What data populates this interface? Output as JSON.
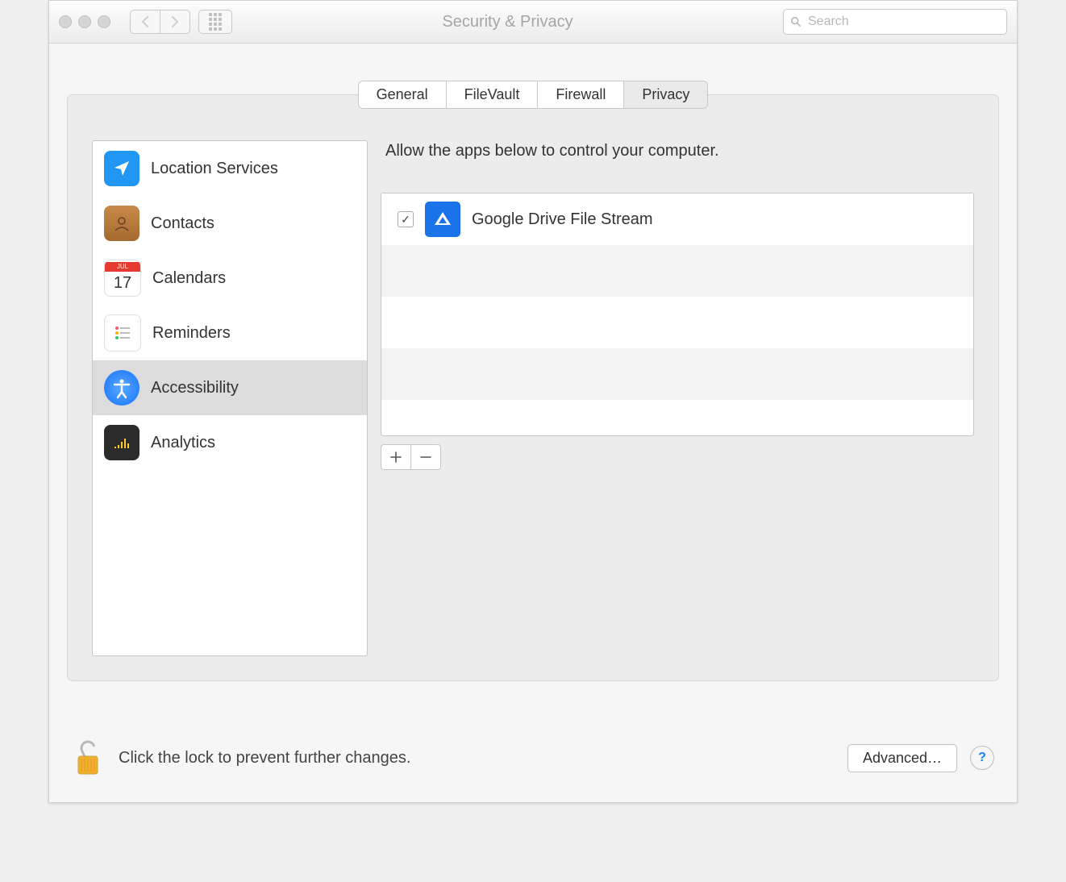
{
  "window": {
    "title": "Security & Privacy",
    "search_placeholder": "Search"
  },
  "tabs": {
    "general": "General",
    "filevault": "FileVault",
    "firewall": "Firewall",
    "privacy": "Privacy",
    "active": "privacy"
  },
  "sidebar": {
    "items": [
      {
        "label": "Location Services",
        "icon": "location"
      },
      {
        "label": "Contacts",
        "icon": "contacts"
      },
      {
        "label": "Calendars",
        "icon": "calendar",
        "badge_text": "JUL",
        "badge_num": "17"
      },
      {
        "label": "Reminders",
        "icon": "reminders"
      },
      {
        "label": "Accessibility",
        "icon": "accessibility"
      },
      {
        "label": "Analytics",
        "icon": "analytics"
      }
    ],
    "selected_index": 4
  },
  "detail": {
    "heading": "Allow the apps below to control your computer.",
    "apps": [
      {
        "name": "Google Drive File Stream",
        "checked": true,
        "icon": "google-drive"
      }
    ]
  },
  "footer": {
    "lock_text": "Click the lock to prevent further changes.",
    "advanced_label": "Advanced…"
  },
  "colors": {
    "accent_blue": "#2196f3",
    "drive_blue": "#1a73e8"
  }
}
